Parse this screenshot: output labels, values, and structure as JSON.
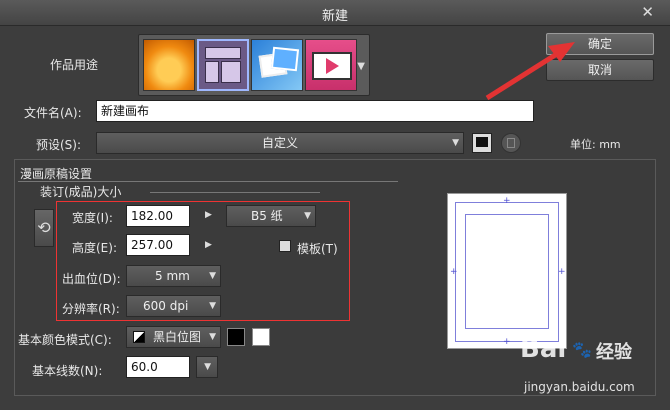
{
  "window": {
    "title": "新建"
  },
  "labels": {
    "purpose": "作品用途",
    "filename": "文件名(A):",
    "preset": "预设(S):",
    "unit": "单位: mm",
    "section_title": "漫画原稿设置",
    "binding_size": "装订(成品)大小",
    "width": "宽度(I):",
    "height": "高度(E):",
    "bleed": "出血位(D):",
    "resolution": "分辨率(R):",
    "template": "模板(T)",
    "color_mode": "基本颜色模式(C):",
    "lines": "基本线数(N):"
  },
  "buttons": {
    "ok": "确定",
    "cancel": "取消"
  },
  "purpose_icons": [
    "illustration-icon",
    "comic-icon",
    "photo-album-icon",
    "animation-icon"
  ],
  "fields": {
    "filename": "新建画布",
    "preset": "自定义",
    "width": "182.00",
    "height": "257.00",
    "paper": "B5 纸",
    "bleed": "5 mm",
    "resolution": "600 dpi",
    "color_mode": "黑白位图",
    "lines": "60.0"
  },
  "checkboxes": {
    "template_checked": false
  },
  "colors": {
    "accent_red": "#e33333",
    "guide_blue": "#5050d0"
  },
  "watermark": {
    "logo_part1": "Bai",
    "logo_part2": "经验",
    "url": "jingyan.baidu.com"
  }
}
